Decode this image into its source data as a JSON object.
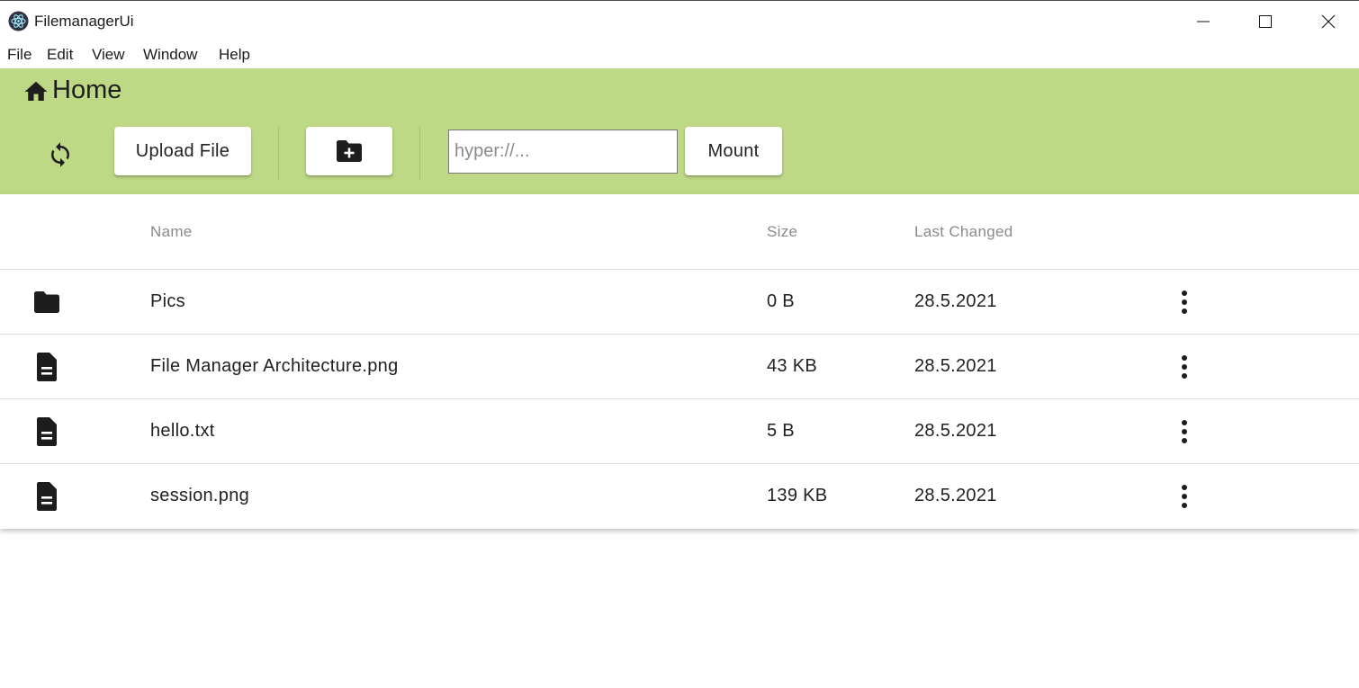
{
  "window": {
    "title": "FilemanagerUi"
  },
  "menu": {
    "items": [
      "File",
      "Edit",
      "View",
      "Window",
      "Help"
    ]
  },
  "header": {
    "title": "Home"
  },
  "toolbar": {
    "upload_label": "Upload File",
    "url_placeholder": "hyper://...",
    "url_value": "",
    "mount_label": "Mount"
  },
  "table": {
    "columns": [
      "Name",
      "Size",
      "Last Changed"
    ],
    "rows": [
      {
        "icon": "folder-icon",
        "name": "Pics",
        "size": "0 B",
        "changed": "28.5.2021"
      },
      {
        "icon": "file-icon",
        "name": "File Manager Architecture.png",
        "size": "43 KB",
        "changed": "28.5.2021"
      },
      {
        "icon": "file-icon",
        "name": "hello.txt",
        "size": "5 B",
        "changed": "28.5.2021"
      },
      {
        "icon": "file-icon",
        "name": "session.png",
        "size": "139 KB",
        "changed": "28.5.2021"
      }
    ]
  },
  "colors": {
    "header_bg": "#bdd985",
    "text": "#212121",
    "muted": "#8a8a8a"
  },
  "icons": [
    "electron-logo-icon",
    "home-icon",
    "refresh-icon",
    "new-folder-icon",
    "folder-icon",
    "file-icon",
    "more-vert-icon",
    "minimize-icon",
    "maximize-icon",
    "close-icon"
  ]
}
